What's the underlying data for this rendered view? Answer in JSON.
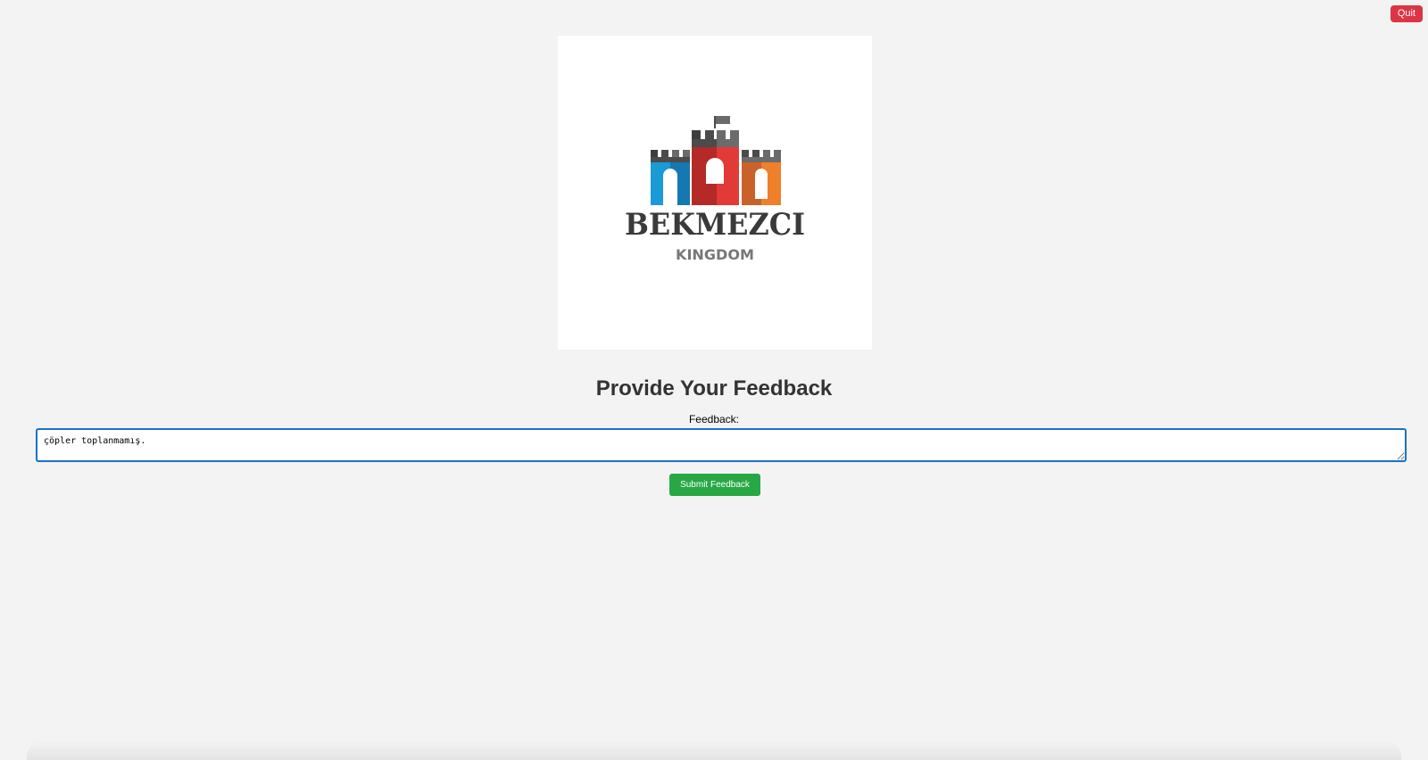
{
  "header": {
    "quit_label": "Quit"
  },
  "logo": {
    "brand_name": "BEKMEZCI",
    "brand_subtitle": "KINGDOM",
    "colors": {
      "tower_left": "#1a9ad6",
      "tower_center": "#d9322f",
      "tower_right": "#ef7f2b",
      "battlements": "#4b4b4b",
      "text_dark": "#3a3a3a",
      "text_grey": "#777777"
    }
  },
  "form": {
    "title": "Provide Your Feedback",
    "label": "Feedback:",
    "value": "çöpler toplanmamış.",
    "submit_label": "Submit Feedback"
  },
  "colors": {
    "background": "#f3f3f3",
    "quit": "#dc3545",
    "submit": "#28a745",
    "focus_border": "#1a73c8"
  }
}
